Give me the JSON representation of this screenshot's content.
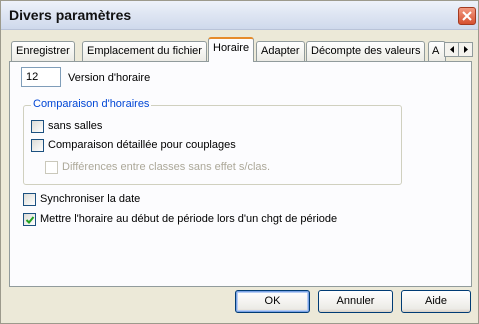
{
  "window": {
    "title": "Divers paramètres"
  },
  "tabs": [
    {
      "label": "Enregistrer",
      "active": false
    },
    {
      "label": "Emplacement du fichier",
      "active": false
    },
    {
      "label": "Horaire",
      "active": true
    },
    {
      "label": "Adapter",
      "active": false
    },
    {
      "label": "Décompte des valeurs",
      "active": false
    },
    {
      "label": "A",
      "active": false
    }
  ],
  "horaire": {
    "version_value": "12",
    "version_label": "Version d'horaire",
    "group_title": "Comparaison d'horaires",
    "sans_salles": {
      "label": "sans salles",
      "checked": false
    },
    "comparaison_detaillee": {
      "label": "Comparaison détaillée pour couplages",
      "checked": false
    },
    "differences_classes": {
      "label": "Différences entre classes sans effet s/clas.",
      "checked": false,
      "disabled": true
    },
    "synchroniser_date": {
      "label": "Synchroniser la date",
      "checked": false
    },
    "mettre_horaire": {
      "label": "Mettre l'horaire au début de période lors d'un chgt de période",
      "checked": true
    }
  },
  "buttons": {
    "ok": "OK",
    "annuler": "Annuler",
    "aide": "Aide"
  },
  "colors": {
    "group_title": "#0046d5",
    "active_tab_accent": "#e68b2c",
    "checkmark": "#21a121",
    "close_button": "#d6502f"
  }
}
